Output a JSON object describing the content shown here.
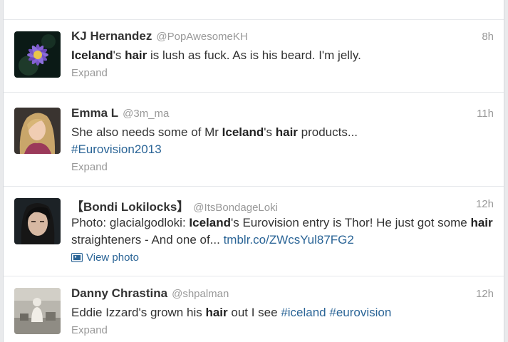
{
  "tweets": [
    {
      "fullname": "KJ Hernandez",
      "username": "@PopAwesomeKH",
      "time": "8h",
      "t1": "Iceland",
      "t2": "'s ",
      "t3": "hair",
      "t4": " is lush as fuck. As is his beard. I'm jelly.",
      "action": "Expand",
      "avatar_icon": "purple-flower-avatar"
    },
    {
      "fullname": "Emma L",
      "username": "@3m_ma",
      "time": "11h",
      "t1": "She also needs some of Mr ",
      "t2": "Iceland",
      "t3": "'s ",
      "t4": "hair",
      "t5": " products...",
      "hashtag": "#Eurovision2013",
      "action": "Expand",
      "avatar_icon": "blonde-woman-avatar"
    },
    {
      "fullname": "【Bondi Lokilocks】",
      "username": "@ItsBondageLoki",
      "time": "12h",
      "t1": "Photo: glacialgodloki: ",
      "t2": "Iceland",
      "t3": "'s Eurovision entry is Thor! He just got some ",
      "t4": "hair",
      "t5": " straighteners - And one of... ",
      "link": "tmblr.co/ZWcsYul87FG2",
      "action": "View photo",
      "avatar_icon": "dark-haired-man-avatar"
    },
    {
      "fullname": "Danny Chrastina",
      "username": "@shpalman",
      "time": "12h",
      "t1": "Eddie Izzard's grown his ",
      "t2": "hair",
      "t3": " out I see ",
      "hashtag1": "#iceland",
      "t4": " ",
      "hashtag2": "#eurovision",
      "action": "Expand",
      "avatar_icon": "vintage-photo-avatar"
    }
  ],
  "colors": {
    "link": "#2a6496",
    "meta": "#999999",
    "text": "#333333"
  }
}
